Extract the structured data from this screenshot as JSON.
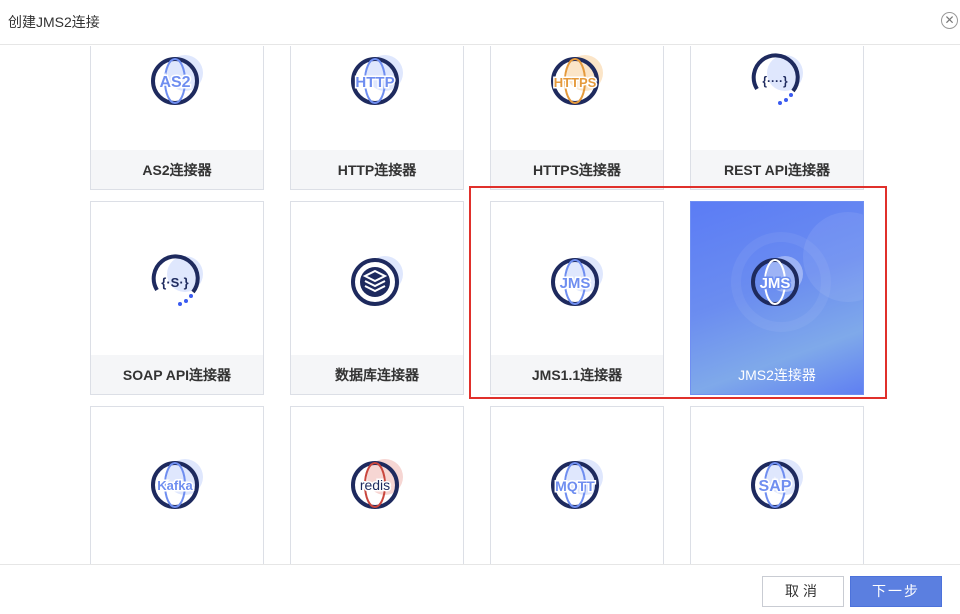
{
  "dialog": {
    "title": "创建JMS2连接",
    "close_glyph": "✕"
  },
  "cards": [
    {
      "label": "AS2连接器",
      "logo_text": "AS2",
      "icon": "as2-icon"
    },
    {
      "label": "HTTP连接器",
      "logo_text": "HTTP",
      "icon": "http-icon"
    },
    {
      "label": "HTTPS连接器",
      "logo_text": "HTTPS",
      "icon": "https-icon"
    },
    {
      "label": "REST API连接器",
      "logo_text": "{····}",
      "icon": "rest-api-icon"
    },
    {
      "label": "SOAP API连接器",
      "logo_text": "{·S·}",
      "icon": "soap-api-icon"
    },
    {
      "label": "数据库连接器",
      "logo_text": "",
      "icon": "database-layers-icon"
    },
    {
      "label": "JMS1.1连接器",
      "logo_text": "JMS",
      "icon": "jms-icon"
    },
    {
      "label": "JMS2连接器",
      "logo_text": "JMS",
      "icon": "jms2-icon",
      "selected": true
    },
    {
      "label": "",
      "logo_text": "Kafka",
      "icon": "kafka-icon"
    },
    {
      "label": "",
      "logo_text": "redis",
      "icon": "redis-icon"
    },
    {
      "label": "",
      "logo_text": "MQTT",
      "icon": "mqtt-icon"
    },
    {
      "label": "",
      "logo_text": "SAP",
      "icon": "sap-icon"
    }
  ],
  "footer": {
    "cancel_label": "取消",
    "next_label": "下一步"
  },
  "colors": {
    "accent": "#5b7fe0",
    "selected_card": "#6b8df0",
    "highlight": "#e0302b",
    "logo_navy": "#1e2a5e",
    "logo_blue": "#6f8ef0",
    "https_orange": "#e59a3c",
    "redis_red": "#c9463d"
  }
}
